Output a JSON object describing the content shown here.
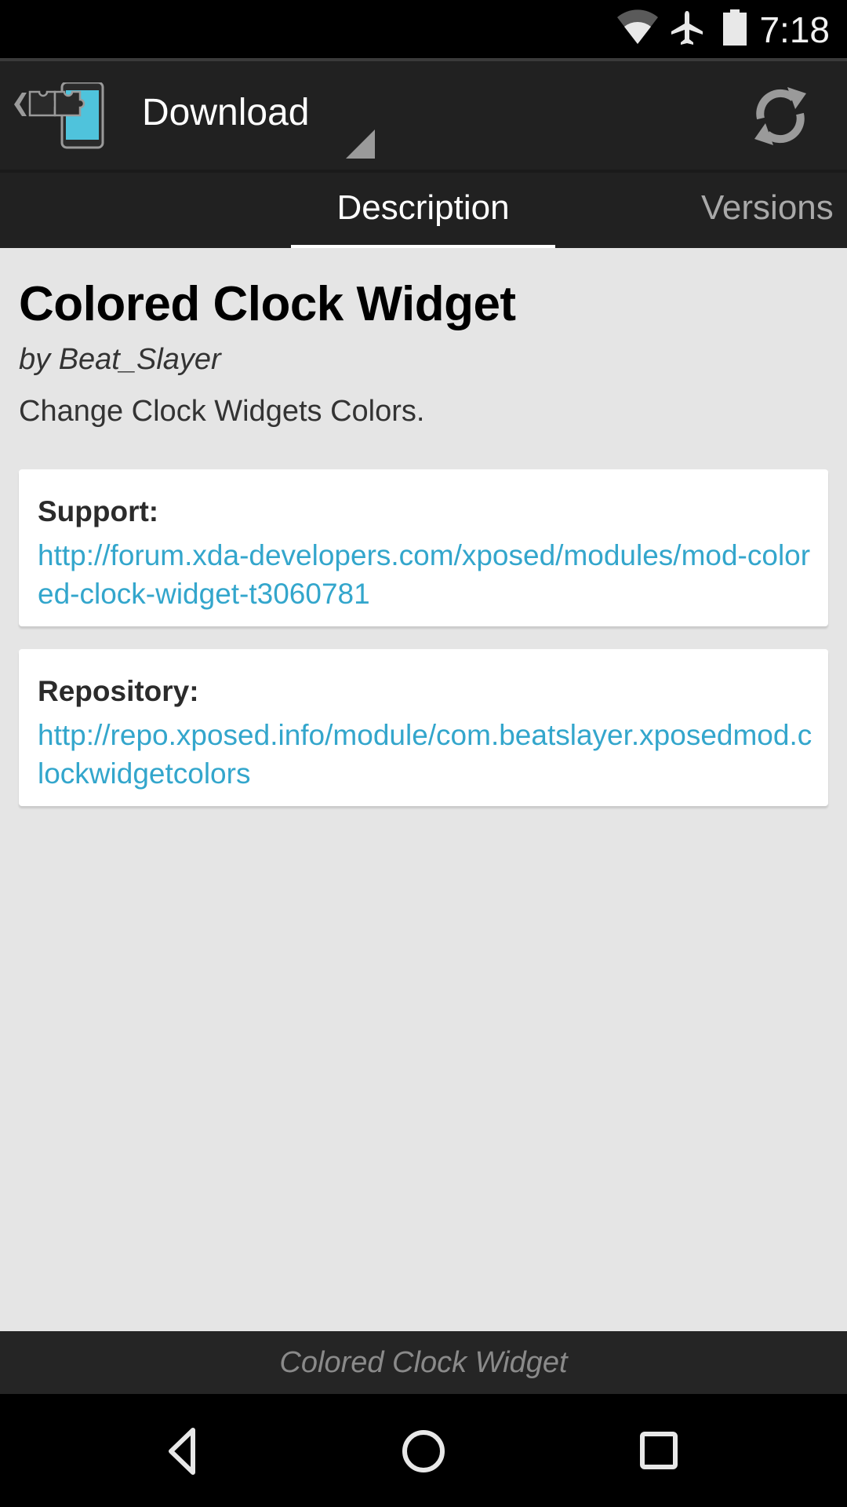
{
  "status_bar": {
    "time": "7:18",
    "icons": [
      "wifi-icon",
      "airplane-mode-icon",
      "battery-icon"
    ]
  },
  "action_bar": {
    "title": "Download",
    "app_icon": "xposed-installer-icon",
    "refresh_icon": "refresh-icon"
  },
  "tabs": [
    {
      "label": "Description",
      "active": true
    },
    {
      "label": "Versions",
      "active": false
    }
  ],
  "module": {
    "title": "Colored Clock Widget",
    "author": "by Beat_Slayer",
    "description": "Change Clock Widgets Colors."
  },
  "cards": {
    "support": {
      "label": "Support:",
      "link": "http://forum.xda-developers.com/xposed/modules/mod-colored-clock-widget-t3060781"
    },
    "repository": {
      "label": "Repository:",
      "link": "http://repo.xposed.info/module/com.beatslayer.xposedmod.clockwidgetcolors"
    }
  },
  "footer": {
    "module_name": "Colored Clock Widget"
  },
  "nav_bar": {
    "buttons": [
      "back",
      "home",
      "recents"
    ]
  },
  "colors": {
    "accent": "#33a6cc",
    "action_bar_bg": "#212121",
    "content_bg": "#e5e5e5",
    "icon_cyan": "#4fc3dc"
  }
}
